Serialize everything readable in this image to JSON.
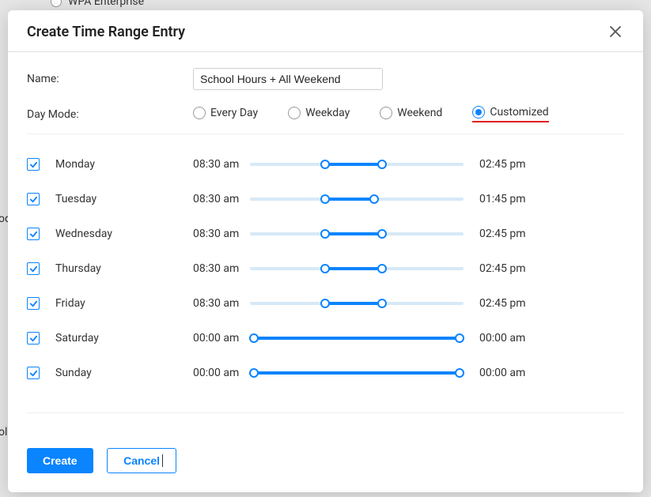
{
  "background": {
    "radio_label": "WPA Enterprise",
    "left_frag_1": "od",
    "left_frag_2": "ol"
  },
  "modal": {
    "title": "Create Time Range Entry",
    "name_label": "Name:",
    "name_value": "School Hours + All Weekend",
    "day_mode_label": "Day Mode:",
    "day_modes": {
      "every_day": "Every Day",
      "weekday": "Weekday",
      "weekend": "Weekend",
      "customized": "Customized"
    },
    "selected_day_mode": "customized",
    "days": [
      {
        "label": "Monday",
        "checked": true,
        "start": "08:30 am",
        "end": "02:45 pm",
        "slider_start_pct": 35,
        "slider_end_pct": 62
      },
      {
        "label": "Tuesday",
        "checked": true,
        "start": "08:30 am",
        "end": "01:45 pm",
        "slider_start_pct": 35,
        "slider_end_pct": 58
      },
      {
        "label": "Wednesday",
        "checked": true,
        "start": "08:30 am",
        "end": "02:45 pm",
        "slider_start_pct": 35,
        "slider_end_pct": 62
      },
      {
        "label": "Thursday",
        "checked": true,
        "start": "08:30 am",
        "end": "02:45 pm",
        "slider_start_pct": 35,
        "slider_end_pct": 62
      },
      {
        "label": "Friday",
        "checked": true,
        "start": "08:30 am",
        "end": "02:45 pm",
        "slider_start_pct": 35,
        "slider_end_pct": 62
      },
      {
        "label": "Saturday",
        "checked": true,
        "start": "00:00 am",
        "end": "00:00 am",
        "slider_start_pct": 2,
        "slider_end_pct": 98
      },
      {
        "label": "Sunday",
        "checked": true,
        "start": "00:00 am",
        "end": "00:00 am",
        "slider_start_pct": 2,
        "slider_end_pct": 98
      }
    ],
    "buttons": {
      "create": "Create",
      "cancel": "Cancel"
    }
  }
}
